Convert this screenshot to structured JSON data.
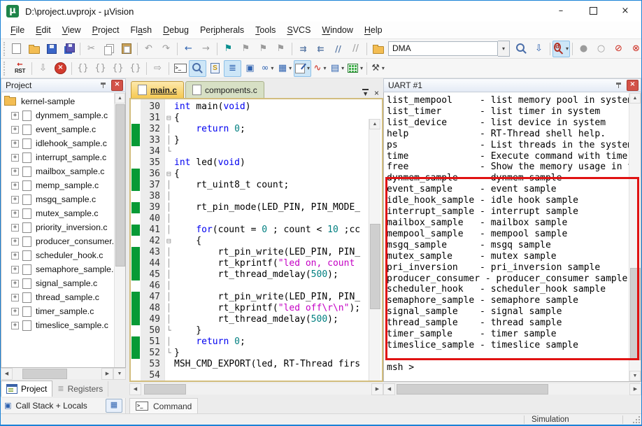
{
  "window": {
    "title": "D:\\project.uvprojx - µVision",
    "controls": [
      {
        "name": "minimize-button",
        "glyph": "–"
      },
      {
        "name": "maximize-button",
        "glyph": ""
      },
      {
        "name": "close-button",
        "glyph": "×"
      }
    ]
  },
  "menu": {
    "items": [
      {
        "label": "File",
        "u": 0
      },
      {
        "label": "Edit",
        "u": 0
      },
      {
        "label": "View",
        "u": 0
      },
      {
        "label": "Project",
        "u": 0
      },
      {
        "label": "Flash",
        "u": 2
      },
      {
        "label": "Debug",
        "u": 0
      },
      {
        "label": "Peripherals",
        "u": 3
      },
      {
        "label": "Tools",
        "u": 0
      },
      {
        "label": "SVCS",
        "u": 0
      },
      {
        "label": "Window",
        "u": 0
      },
      {
        "label": "Help",
        "u": 0
      }
    ]
  },
  "icons": {
    "dropdown": "▾",
    "plus": "+",
    "close": "×",
    "tablist": "▼",
    "up": "▲",
    "down": "▼",
    "left": "◀",
    "right": "▶"
  },
  "toolbar1": [
    {
      "name": "new-file-button",
      "css": "i-page"
    },
    {
      "name": "open-file-button",
      "css": "i-folder"
    },
    {
      "name": "save-button",
      "css": "i-disk"
    },
    {
      "name": "save-all-button",
      "css": "i-disk2"
    },
    {
      "sep": 1
    },
    {
      "name": "cut-button",
      "g": "✂",
      "tone": "gray"
    },
    {
      "name": "copy-button",
      "css": "i-copy"
    },
    {
      "name": "paste-button",
      "css": "i-paste"
    },
    {
      "sep": 1
    },
    {
      "name": "undo-button",
      "g": "↶",
      "tone": "gray"
    },
    {
      "name": "redo-button",
      "g": "↷",
      "tone": "gray"
    },
    {
      "sep": 1
    },
    {
      "name": "navigate-back-button",
      "g": "←",
      "tone": "blue"
    },
    {
      "name": "navigate-forward-button",
      "g": "→",
      "tone": "gray"
    },
    {
      "sep": 1
    },
    {
      "name": "insert-bookmark-button",
      "g": "⚑",
      "tone": "teal"
    },
    {
      "name": "next-bookmark-button",
      "g": "⚑",
      "tone": "gray"
    },
    {
      "name": "prev-bookmark-button",
      "g": "⚑",
      "tone": "gray"
    },
    {
      "name": "clear-bookmarks-button",
      "g": "⚑",
      "tone": "gray"
    },
    {
      "sep": 1
    },
    {
      "name": "indent-button",
      "g": "⇉",
      "tone": "steel"
    },
    {
      "name": "outdent-button",
      "g": "⇇",
      "tone": "steel"
    },
    {
      "name": "comment-button",
      "g": "//",
      "tone": "steel"
    },
    {
      "name": "uncomment-button",
      "g": "//",
      "tone": "gray"
    },
    {
      "sep": 1
    },
    {
      "name": "flash-download-button",
      "css": "i-folder"
    },
    {
      "combo": 1,
      "name": "target-select",
      "value": "DMA"
    },
    {
      "name": "find-in-files-button",
      "css": "i-mag"
    },
    {
      "name": "find-button",
      "g": "⇩",
      "tone": "blue"
    },
    {
      "sep": 1
    },
    {
      "name": "debug-session-button",
      "css": "i-magd",
      "t": "d",
      "on": 1,
      "d": 1
    },
    {
      "sep": 1
    },
    {
      "name": "insert-breakpoint-button",
      "g": "●",
      "tone": "gray"
    },
    {
      "name": "enable-breakpoint-button",
      "g": "○",
      "tone": "gray"
    },
    {
      "name": "disable-all-breakpoints-button",
      "g": "⊘",
      "tone": "red"
    },
    {
      "name": "kill-all-breakpoints-button",
      "g": "⊗",
      "tone": "red"
    },
    {
      "sep": 1
    },
    {
      "name": "project-window-button",
      "css": "i-winlist",
      "on": 1
    }
  ],
  "toolbar2": [
    {
      "special": "rst",
      "name": "reset-button",
      "arrow": "←",
      "label": "RST"
    },
    {
      "sep": 1
    },
    {
      "name": "run-button",
      "g": "⇩",
      "tone": "gray"
    },
    {
      "name": "stop-button",
      "css": "i-stop",
      "t": "×"
    },
    {
      "sep": 1
    },
    {
      "name": "step-button",
      "g": "{}",
      "tone": "gray"
    },
    {
      "name": "step-over-button",
      "g": "{}",
      "tone": "gray"
    },
    {
      "name": "step-out-button",
      "g": "{}",
      "tone": "gray"
    },
    {
      "name": "run-to-cursor-button",
      "g": "{}",
      "tone": "gray"
    },
    {
      "sep": 1
    },
    {
      "name": "show-next-statement-button",
      "g": "⇨",
      "tone": "gray"
    },
    {
      "sep": 1
    },
    {
      "name": "command-window-button",
      "css": "i-term",
      "t": ">_"
    },
    {
      "name": "disassembly-window-button",
      "css": "i-mag",
      "on": 1
    },
    {
      "name": "symbols-window-button",
      "css": "i-sdoc",
      "t": "S"
    },
    {
      "name": "registers-window-button",
      "g": "≣",
      "tone": "blue",
      "on": 1
    },
    {
      "name": "callstack-window-button",
      "g": "▣",
      "tone": "blue"
    },
    {
      "name": "watch-window-button",
      "g": "∞",
      "tone": "blue",
      "d": 1
    },
    {
      "name": "memory-window-button",
      "g": "▦",
      "tone": "blue",
      "d": 1
    },
    {
      "name": "serial-window-button",
      "css": "i-serial",
      "on": 1,
      "d": 1
    },
    {
      "name": "analysis-window-button",
      "g": "∿",
      "tone": "red",
      "d": 1
    },
    {
      "name": "system-viewer-button",
      "g": "▤",
      "tone": "blue",
      "d": 1
    },
    {
      "name": "toolbox-button",
      "css": "i-toolbox",
      "d": 1
    },
    {
      "sep": 1
    },
    {
      "name": "tools-button",
      "g": "⚒",
      "tone": "dark",
      "d": 1
    }
  ],
  "project": {
    "title": "Project",
    "root": "kernel-sample",
    "files": [
      "dynmem_sample.c",
      "event_sample.c",
      "idlehook_sample.c",
      "interrupt_sample.c",
      "mailbox_sample.c",
      "memp_sample.c",
      "msgq_sample.c",
      "mutex_sample.c",
      "priority_inversion.c",
      "producer_consumer.c",
      "scheduler_hook.c",
      "semaphore_sample.c",
      "signal_sample.c",
      "thread_sample.c",
      "timer_sample.c",
      "timeslice_sample.c"
    ],
    "tabs": [
      {
        "label": "Project",
        "active": true
      },
      {
        "label": "Registers",
        "active": false
      }
    ]
  },
  "editor": {
    "tabs": [
      {
        "label": "main.c",
        "active": true
      },
      {
        "label": "components.c",
        "active": false
      }
    ],
    "lines": [
      {
        "n": 30,
        "g": 0,
        "f": "",
        "s": [
          [
            "int",
            "k"
          ],
          [
            " main(",
            "p"
          ],
          [
            "void",
            "k"
          ],
          [
            ")",
            "p"
          ]
        ]
      },
      {
        "n": 31,
        "g": 0,
        "f": "⊟",
        "s": [
          [
            "{",
            "p"
          ]
        ]
      },
      {
        "n": 32,
        "g": 1,
        "f": "│",
        "s": [
          [
            "    ",
            "p"
          ],
          [
            "return",
            "k"
          ],
          [
            " ",
            "p"
          ],
          [
            "0",
            "n"
          ],
          [
            ";",
            "p"
          ]
        ]
      },
      {
        "n": 33,
        "g": 1,
        "f": "│",
        "s": [
          [
            "}",
            "p"
          ]
        ]
      },
      {
        "n": 34,
        "g": 0,
        "f": "└",
        "s": []
      },
      {
        "n": 35,
        "g": 0,
        "f": "",
        "s": [
          [
            "int",
            "k"
          ],
          [
            " led(",
            "p"
          ],
          [
            "void",
            "k"
          ],
          [
            ")",
            "p"
          ]
        ]
      },
      {
        "n": 36,
        "g": 1,
        "f": "⊟",
        "s": [
          [
            "{",
            "p"
          ]
        ]
      },
      {
        "n": 37,
        "g": 1,
        "f": "│",
        "s": [
          [
            "    rt_uint8_t count;",
            "p"
          ]
        ]
      },
      {
        "n": 38,
        "g": 0,
        "f": "│",
        "s": []
      },
      {
        "n": 39,
        "g": 1,
        "f": "│",
        "s": [
          [
            "    rt_pin_mode(LED_PIN, PIN_MODE_",
            "p"
          ]
        ]
      },
      {
        "n": 40,
        "g": 0,
        "f": "│",
        "s": []
      },
      {
        "n": 41,
        "g": 1,
        "f": "│",
        "s": [
          [
            "    ",
            "p"
          ],
          [
            "for",
            "k"
          ],
          [
            "(count = ",
            "p"
          ],
          [
            "0",
            "n"
          ],
          [
            " ; count < ",
            "p"
          ],
          [
            "10",
            "n"
          ],
          [
            " ;cc",
            "p"
          ]
        ]
      },
      {
        "n": 42,
        "g": 0,
        "f": "⊟",
        "s": [
          [
            "    {",
            "p"
          ]
        ]
      },
      {
        "n": 43,
        "g": 1,
        "f": "│",
        "s": [
          [
            "        rt_pin_write(LED_PIN, PIN_",
            "p"
          ]
        ]
      },
      {
        "n": 44,
        "g": 1,
        "f": "│",
        "s": [
          [
            "        rt_kprintf(",
            "p"
          ],
          [
            "\"led on, count",
            "s"
          ]
        ]
      },
      {
        "n": 45,
        "g": 1,
        "f": "│",
        "s": [
          [
            "        rt_thread_mdelay(",
            "p"
          ],
          [
            "500",
            "n"
          ],
          [
            ");",
            "p"
          ]
        ]
      },
      {
        "n": 46,
        "g": 0,
        "f": "│",
        "s": []
      },
      {
        "n": 47,
        "g": 1,
        "f": "│",
        "s": [
          [
            "        rt_pin_write(LED_PIN, PIN_",
            "p"
          ]
        ]
      },
      {
        "n": 48,
        "g": 1,
        "f": "│",
        "s": [
          [
            "        rt_kprintf(",
            "p"
          ],
          [
            "\"led off\\r\\n\"",
            "s"
          ],
          [
            ");",
            "p"
          ]
        ]
      },
      {
        "n": 49,
        "g": 1,
        "f": "│",
        "s": [
          [
            "        rt_thread_mdelay(",
            "p"
          ],
          [
            "500",
            "n"
          ],
          [
            ");",
            "p"
          ]
        ]
      },
      {
        "n": 50,
        "g": 0,
        "f": "└",
        "s": [
          [
            "    }",
            "p"
          ]
        ]
      },
      {
        "n": 51,
        "g": 1,
        "f": "│",
        "s": [
          [
            "    ",
            "p"
          ],
          [
            "return",
            "k"
          ],
          [
            " ",
            "p"
          ],
          [
            "0",
            "n"
          ],
          [
            ";",
            "p"
          ]
        ]
      },
      {
        "n": 52,
        "g": 1,
        "f": "└",
        "s": [
          [
            "}",
            "p"
          ]
        ]
      },
      {
        "n": 53,
        "g": 0,
        "f": "",
        "s": [
          [
            "MSH_CMD_EXPORT(led, RT-Thread firs",
            "p"
          ]
        ]
      },
      {
        "n": 54,
        "g": 0,
        "f": "",
        "s": []
      }
    ]
  },
  "uart": {
    "title": "UART #1",
    "lines": [
      "list_mempool     - list memory pool in system",
      "list_timer       - list timer in system",
      "list_device      - list device in system",
      "help             - RT-Thread shell help.",
      "ps               - List threads in the system.",
      "time             - Execute command with time.",
      "free             - Show the memory usage in the system.",
      "dynmem_sample    - dynmem sample",
      "event_sample     - event sample",
      "idle_hook_sample - idle hook sample",
      "interrupt_sample - interrupt sample",
      "mailbox_sample   - mailbox sample",
      "mempool_sample   - mempool sample",
      "msgq_sample      - msgq sample",
      "mutex_sample     - mutex sample",
      "pri_inversion    - pri_inversion sample",
      "producer_consumer - producer_consumer sample",
      "scheduler_hook   - scheduler_hook sample",
      "semaphore_sample - semaphore sample",
      "signal_sample    - signal sample",
      "thread_sample    - thread sample",
      "timer_sample     - timer sample",
      "timeslice_sample - timeslice sample",
      ""
    ],
    "prompt": "msh >"
  },
  "docks": {
    "call_stack": "Call Stack + Locals",
    "command": "Command"
  },
  "status": {
    "simulation": "Simulation"
  }
}
